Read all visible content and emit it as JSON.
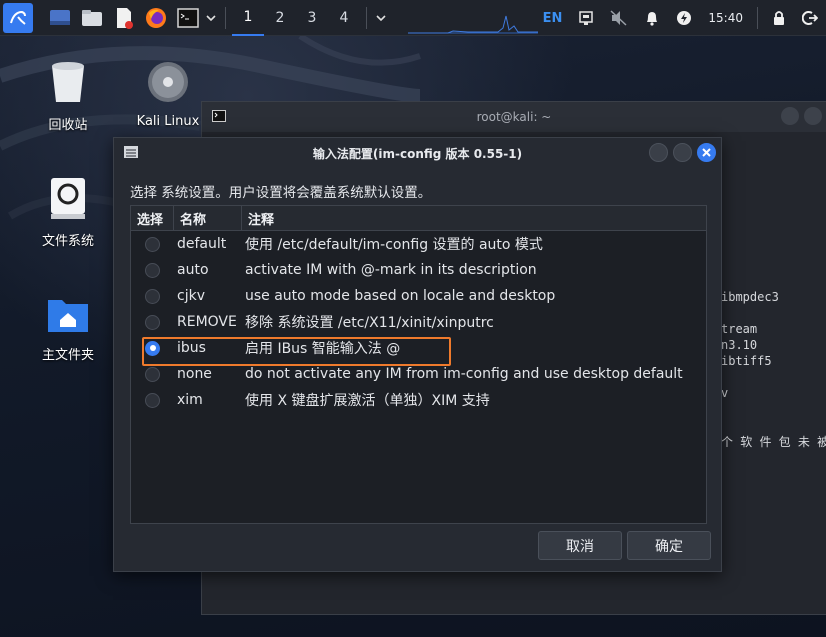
{
  "panel": {
    "workspaces": [
      "1",
      "2",
      "3",
      "4"
    ],
    "active_workspace": "1",
    "input_method": "EN",
    "clock": "15:40",
    "icons": [
      "kali-menu-icon",
      "desktop-icon",
      "file-manager-icon",
      "text-editor-icon",
      "firefox-icon",
      "terminal-icon",
      "chevron-down-icon",
      "network-icon",
      "mute-icon",
      "bell-icon",
      "power-manager-icon",
      "lock-icon",
      "logout-icon"
    ]
  },
  "desktop": {
    "icons": [
      {
        "label": "回收站",
        "icon": "trash-icon"
      },
      {
        "label": "Kali Linux",
        "icon": "disc-icon"
      },
      {
        "label": "文件系统",
        "icon": "drive-icon"
      },
      {
        "label": "主文件夹",
        "icon": "home-folder-icon"
      }
    ]
  },
  "terminal": {
    "title": "root@kali: ~",
    "visible_lines": [
      "ibmpdec3",
      "tream",
      "n3.10",
      "ibtiff5",
      "v",
      "个 软 件 包 未 被"
    ]
  },
  "dialog": {
    "title": "输入法配置(im-config 版本 0.55-1)",
    "description": "选择 系统设置。用户设置将会覆盖系统默认设置。",
    "columns": [
      "选择",
      "名称",
      "注释"
    ],
    "rows": [
      {
        "name": "default",
        "comment": "使用 /etc/default/im-config 设置的 auto 模式",
        "selected": false
      },
      {
        "name": "auto",
        "comment": "activate IM with @-mark in its description",
        "selected": false
      },
      {
        "name": "cjkv",
        "comment": "use auto mode based on locale and desktop",
        "selected": false
      },
      {
        "name": "REMOVE",
        "comment": "移除 系统设置 /etc/X11/xinit/xinputrc",
        "selected": false
      },
      {
        "name": "ibus",
        "comment": "启用 IBus 智能输入法 @",
        "selected": true
      },
      {
        "name": "none",
        "comment": "do not activate any IM from im-config and use desktop default",
        "selected": false
      },
      {
        "name": "xim",
        "comment": "使用 X 键盘扩展激活（单独）XIM 支持",
        "selected": false
      }
    ],
    "cancel_label": "取消",
    "ok_label": "确定"
  },
  "colors": {
    "accent": "#367bf0",
    "highlight_border": "#ef7a2c",
    "dialog_bg": "#262a32"
  }
}
